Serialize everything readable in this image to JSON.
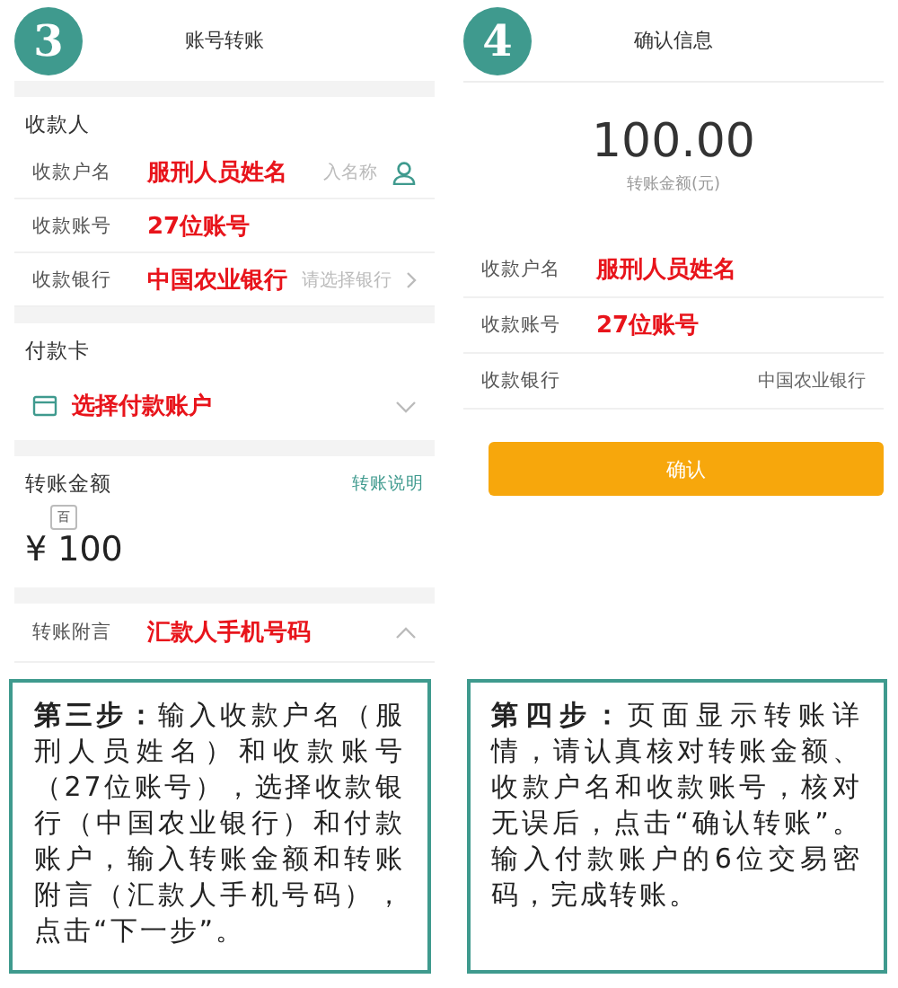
{
  "panels": [
    {
      "badge": "3",
      "title": "账号转账",
      "sections": [
        {
          "kind": "payee",
          "heading": "收款人",
          "rows": [
            {
              "kind": "contact",
              "label": "收款户名",
              "note": "服刑人员姓名",
              "placeholder": "入名称"
            },
            {
              "kind": "text",
              "label": "收款账号",
              "note": "27位账号"
            },
            {
              "kind": "picker",
              "label": "收款银行",
              "note": "中国农业银行",
              "placeholder": "请选择银行"
            }
          ]
        },
        {
          "kind": "card",
          "heading": "付款卡",
          "note": "选择付款账户"
        },
        {
          "kind": "amount",
          "heading": "转账金额",
          "link": "转账说明",
          "tip": "百",
          "currency": "¥",
          "amount": "100"
        },
        {
          "kind": "memo",
          "label": "转账附言",
          "note": "汇款人手机号码"
        }
      ]
    },
    {
      "badge": "4",
      "title": "确认信息",
      "sections": [
        {
          "kind": "summary",
          "amount": "100.00",
          "caption": "转账金额(元)"
        },
        {
          "kind": "details",
          "rows": [
            {
              "label": "收款户名",
              "note": "服刑人员姓名"
            },
            {
              "label": "收款账号",
              "note": "27位账号"
            },
            {
              "label": "收款银行",
              "value": "中国农业银行"
            }
          ]
        },
        {
          "kind": "button",
          "label": "确认"
        }
      ]
    }
  ],
  "captions": [
    "**第三步：**输入收款户名（服刑人员姓名）和收款账号（27位账号），选择收款银行（中国农业银行）和付款账户，输入转账金额和转账附言（汇款人手机号码），点击“下一步”。",
    "**第四步：**页面显示转账详情，请认真核对转账金额、收款户名和收款账号，核对无误后，点击“确认转账”。输入付款账户的6位交易密码，完成转账。"
  ]
}
